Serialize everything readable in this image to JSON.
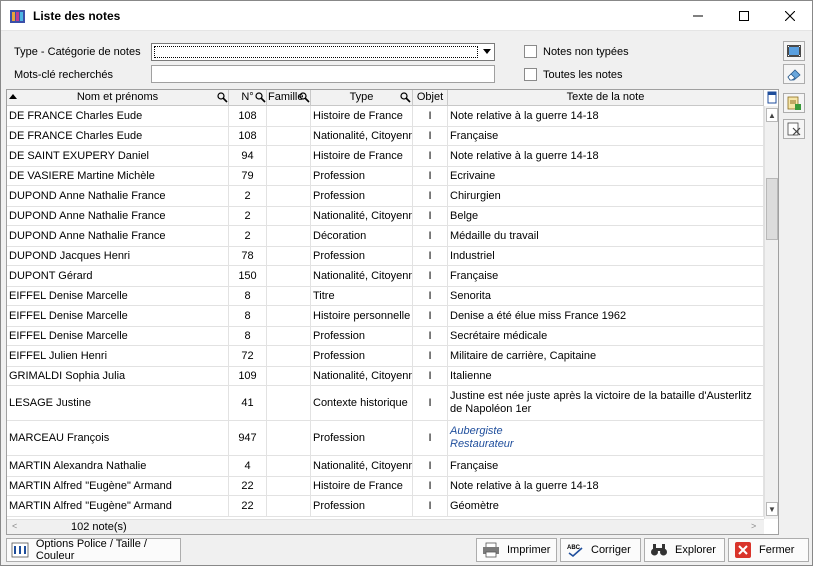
{
  "window": {
    "title": "Liste des notes"
  },
  "filters": {
    "type_label": "Type - Catégorie de notes",
    "type_value": "",
    "keywords_label": "Mots-clé recherchés",
    "keywords_value": "",
    "untyped_label": "Notes non typées",
    "all_label": "Toutes les notes"
  },
  "grid": {
    "columns": [
      "Nom et prénoms",
      "N°",
      "Famille",
      "Type",
      "Objet",
      "Texte de la note"
    ],
    "rows": [
      {
        "name": "DE FRANCE Charles Eude",
        "num": "108",
        "famille": "",
        "type": "Histoire de France",
        "objet": "I",
        "note": [
          "Note relative à la guerre 14-18"
        ]
      },
      {
        "name": "DE FRANCE Charles Eude",
        "num": "108",
        "famille": "",
        "type": "Nationalité, Citoyenn",
        "objet": "I",
        "note": [
          "Française"
        ]
      },
      {
        "name": "DE SAINT EXUPERY Daniel",
        "num": "94",
        "famille": "",
        "type": "Histoire de France",
        "objet": "I",
        "note": [
          "Note relative à la guerre 14-18"
        ]
      },
      {
        "name": "DE VASIERE Martine Michèle",
        "num": "79",
        "famille": "",
        "type": "Profession",
        "objet": "I",
        "note": [
          "Ecrivaine"
        ]
      },
      {
        "name": "DUPOND Anne Nathalie France",
        "num": "2",
        "famille": "",
        "type": "Profession",
        "objet": "I",
        "note": [
          "Chirurgien"
        ]
      },
      {
        "name": "DUPOND Anne Nathalie France",
        "num": "2",
        "famille": "",
        "type": "Nationalité, Citoyenn",
        "objet": "I",
        "note": [
          "Belge"
        ]
      },
      {
        "name": "DUPOND Anne Nathalie France",
        "num": "2",
        "famille": "",
        "type": "Décoration",
        "objet": "I",
        "note": [
          "Médaille du travail"
        ]
      },
      {
        "name": "DUPOND Jacques Henri",
        "num": "78",
        "famille": "",
        "type": "Profession",
        "objet": "I",
        "note": [
          "Industriel"
        ]
      },
      {
        "name": "DUPONT Gérard",
        "num": "150",
        "famille": "",
        "type": "Nationalité, Citoyenn",
        "objet": "I",
        "note": [
          "Française"
        ]
      },
      {
        "name": "EIFFEL Denise Marcelle",
        "num": "8",
        "famille": "",
        "type": "Titre",
        "objet": "I",
        "note": [
          "Senorita"
        ]
      },
      {
        "name": "EIFFEL Denise Marcelle",
        "num": "8",
        "famille": "",
        "type": "Histoire personnelle",
        "objet": "I",
        "note": [
          "Denise a été élue miss France 1962"
        ]
      },
      {
        "name": "EIFFEL Denise Marcelle",
        "num": "8",
        "famille": "",
        "type": "Profession",
        "objet": "I",
        "note": [
          "Secrétaire médicale"
        ]
      },
      {
        "name": "EIFFEL Julien Henri",
        "num": "72",
        "famille": "",
        "type": "Profession",
        "objet": "I",
        "note": [
          "Militaire de carrière, Capitaine"
        ]
      },
      {
        "name": "GRIMALDI Sophia Julia",
        "num": "109",
        "famille": "",
        "type": "Nationalité, Citoyenn",
        "objet": "I",
        "note": [
          "Italienne"
        ]
      },
      {
        "name": "LESAGE Justine",
        "num": "41",
        "famille": "",
        "type": "Contexte historique",
        "objet": "I",
        "note": [
          "Justine est née juste après la victoire de la bataille d'Austerlitz",
          "de Napoléon 1er"
        ]
      },
      {
        "name": "MARCEAU François",
        "num": "947",
        "famille": "",
        "type": "Profession",
        "objet": "I",
        "note": [
          "Aubergiste",
          "Restaurateur"
        ],
        "styled": true
      },
      {
        "name": "MARTIN Alexandra Nathalie",
        "num": "4",
        "famille": "",
        "type": "Nationalité, Citoyenn",
        "objet": "I",
        "note": [
          "Française"
        ]
      },
      {
        "name": "MARTIN Alfred \"Eugène\" Armand",
        "num": "22",
        "famille": "",
        "type": "Histoire de France",
        "objet": "I",
        "note": [
          "Note relative à la guerre 14-18"
        ]
      },
      {
        "name": "MARTIN Alfred \"Eugène\" Armand",
        "num": "22",
        "famille": "",
        "type": "Profession",
        "objet": "I",
        "note": [
          "Géomètre"
        ]
      }
    ]
  },
  "status": {
    "count": "102  note(s)"
  },
  "buttons": {
    "options": "Options Police / Taille / Couleur",
    "print": "Imprimer",
    "correct": "Corriger",
    "explore": "Explorer",
    "close": "Fermer"
  },
  "colors": {
    "styled_note": "#1f4e9c",
    "close_icon": "#d9342b"
  }
}
